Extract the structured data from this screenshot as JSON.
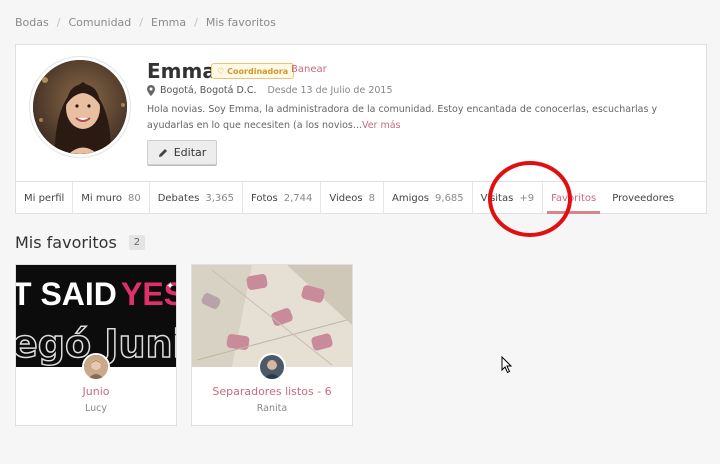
{
  "breadcrumb": [
    "Bodas",
    "Comunidad",
    "Emma",
    "Mis favoritos"
  ],
  "profile": {
    "name": "Emma",
    "role": "Coordinadora",
    "ban_label": "Banear",
    "location": "Bogotá, Bogotá D.C.",
    "since": "Desde 13 de Julio de 2015",
    "bio": "Hola novias. Soy Emma, la administradora de la comunidad. Estoy encantada de conocerlas, escucharlas y ayudarlas en lo que necesiten (a los novios...",
    "more_label": "Ver más",
    "edit_label": "Editar"
  },
  "tabs": [
    {
      "label": "Mi perfil",
      "count": ""
    },
    {
      "label": "Mi muro",
      "count": "80"
    },
    {
      "label": "Debates",
      "count": "3,365"
    },
    {
      "label": "Fotos",
      "count": "2,744"
    },
    {
      "label": "Videos",
      "count": "8"
    },
    {
      "label": "Amigos",
      "count": "9,685"
    },
    {
      "label": "Visitas",
      "count": "+9"
    },
    {
      "label": "Favoritos",
      "count": ""
    },
    {
      "label": "Proveedores",
      "count": ""
    }
  ],
  "active_tab": "Favoritos",
  "favorites": {
    "title": "Mis favoritos",
    "count": "2",
    "items": [
      {
        "title": "Junio",
        "owner": "Lucy",
        "cover_text_1": "T SAID",
        "cover_text_2": "YES",
        "cover_text_3": "egó Juni"
      },
      {
        "title": "Separadores listos - 6",
        "owner": "Ranita"
      }
    ]
  },
  "colors": {
    "accent": "#c86a7f",
    "annotation": "#e01010",
    "badge_gold": "#c99a2e"
  }
}
